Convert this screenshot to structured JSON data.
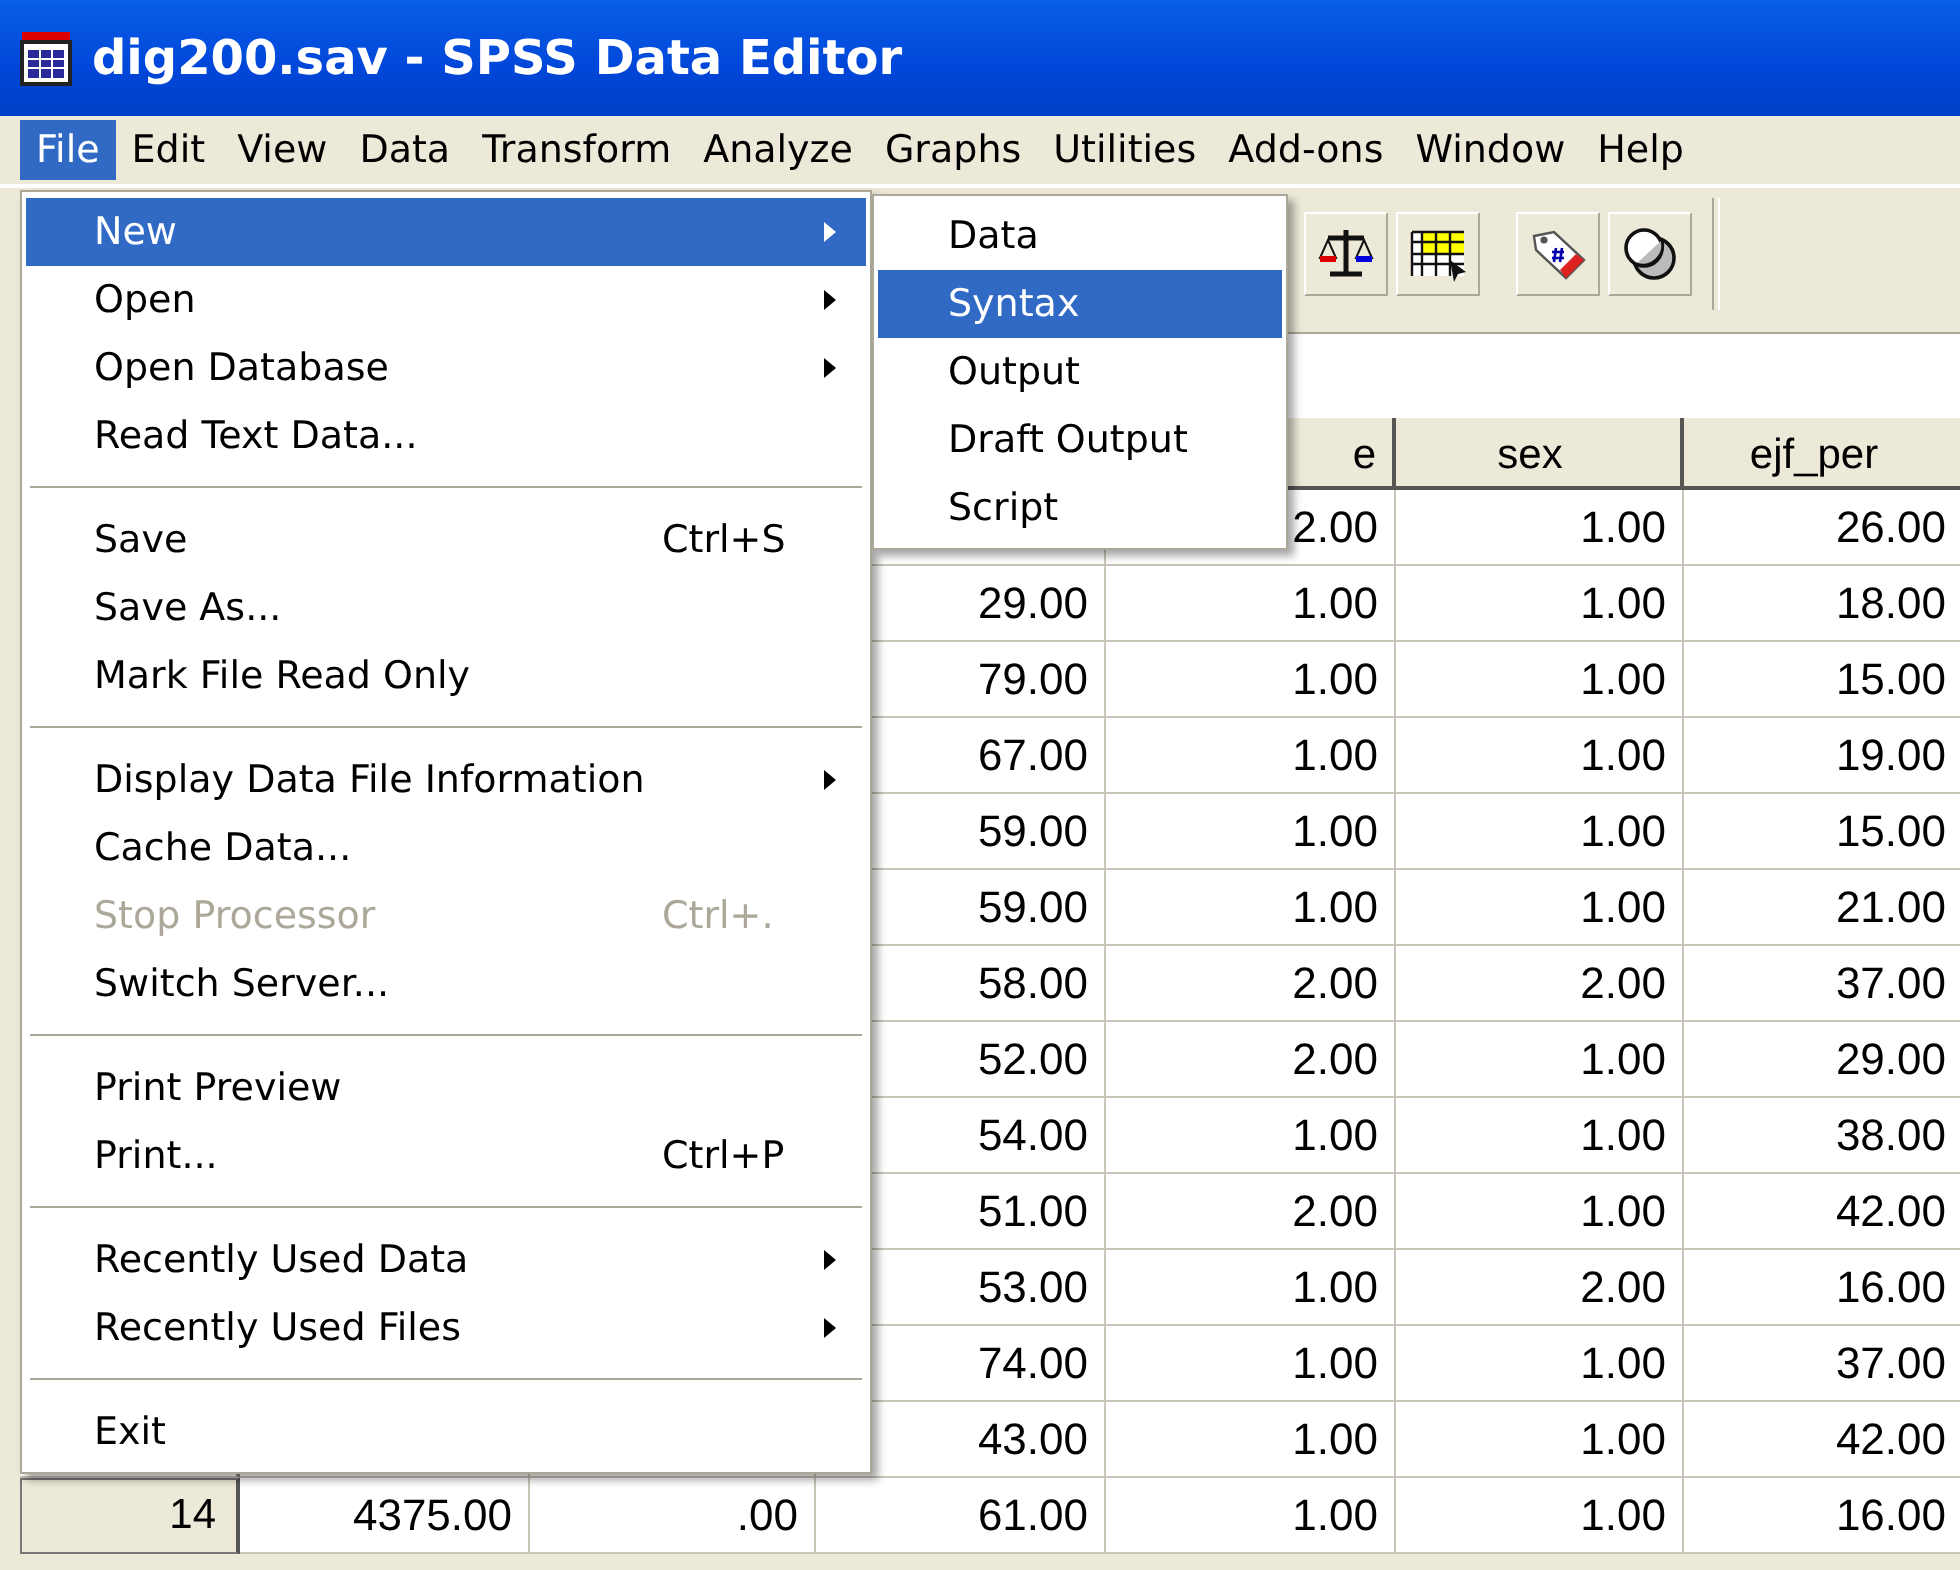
{
  "window": {
    "title": "dig200.sav - SPSS Data Editor"
  },
  "menu_bar": [
    {
      "label": "File",
      "selected": true
    },
    {
      "label": "Edit",
      "selected": false
    },
    {
      "label": "View",
      "selected": false
    },
    {
      "label": "Data",
      "selected": false
    },
    {
      "label": "Transform",
      "selected": false
    },
    {
      "label": "Analyze",
      "selected": false
    },
    {
      "label": "Graphs",
      "selected": false
    },
    {
      "label": "Utilities",
      "selected": false
    },
    {
      "label": "Add-ons",
      "selected": false
    },
    {
      "label": "Window",
      "selected": false
    },
    {
      "label": "Help",
      "selected": false
    }
  ],
  "file_menu": [
    {
      "kind": "item",
      "label": "New",
      "submenu": true,
      "selected": true,
      "disabled": false
    },
    {
      "kind": "item",
      "label": "Open",
      "submenu": true,
      "selected": false,
      "disabled": false
    },
    {
      "kind": "item",
      "label": "Open Database",
      "submenu": true,
      "selected": false,
      "disabled": false
    },
    {
      "kind": "item",
      "label": "Read Text Data...",
      "submenu": false,
      "selected": false,
      "disabled": false
    },
    {
      "kind": "separator"
    },
    {
      "kind": "item",
      "label": "Save",
      "shortcut": "Ctrl+S",
      "submenu": false,
      "selected": false,
      "disabled": false
    },
    {
      "kind": "item",
      "label": "Save As...",
      "submenu": false,
      "selected": false,
      "disabled": false
    },
    {
      "kind": "item",
      "label": "Mark File Read Only",
      "submenu": false,
      "selected": false,
      "disabled": false
    },
    {
      "kind": "separator"
    },
    {
      "kind": "item",
      "label": "Display Data File Information",
      "submenu": true,
      "selected": false,
      "disabled": false
    },
    {
      "kind": "item",
      "label": "Cache Data...",
      "submenu": false,
      "selected": false,
      "disabled": false
    },
    {
      "kind": "item",
      "label": "Stop Processor",
      "shortcut": "Ctrl+.",
      "submenu": false,
      "selected": false,
      "disabled": true
    },
    {
      "kind": "item",
      "label": "Switch Server...",
      "submenu": false,
      "selected": false,
      "disabled": false
    },
    {
      "kind": "separator"
    },
    {
      "kind": "item",
      "label": "Print Preview",
      "submenu": false,
      "selected": false,
      "disabled": false
    },
    {
      "kind": "item",
      "label": "Print...",
      "shortcut": "Ctrl+P",
      "submenu": false,
      "selected": false,
      "disabled": false
    },
    {
      "kind": "separator"
    },
    {
      "kind": "item",
      "label": "Recently Used Data",
      "submenu": true,
      "selected": false,
      "disabled": false
    },
    {
      "kind": "item",
      "label": "Recently Used Files",
      "submenu": true,
      "selected": false,
      "disabled": false
    },
    {
      "kind": "separator"
    },
    {
      "kind": "item",
      "label": "Exit",
      "submenu": false,
      "selected": false,
      "disabled": false
    }
  ],
  "new_submenu": [
    {
      "label": "Data",
      "selected": false
    },
    {
      "label": "Syntax",
      "selected": true
    },
    {
      "label": "Output",
      "selected": false
    },
    {
      "label": "Draft Output",
      "selected": false
    },
    {
      "label": "Script",
      "selected": false
    }
  ],
  "grid": {
    "columns": [
      null,
      null,
      null,
      "e",
      "sex",
      "ejf_per"
    ],
    "rows": [
      {
        "header": null,
        "cells": [
          null,
          null,
          null,
          "2.00",
          "1.00",
          "26.00"
        ]
      },
      {
        "header": null,
        "cells": [
          null,
          null,
          "29.00",
          "1.00",
          "1.00",
          "18.00"
        ]
      },
      {
        "header": null,
        "cells": [
          null,
          null,
          "79.00",
          "1.00",
          "1.00",
          "15.00"
        ]
      },
      {
        "header": null,
        "cells": [
          null,
          null,
          "67.00",
          "1.00",
          "1.00",
          "19.00"
        ]
      },
      {
        "header": null,
        "cells": [
          null,
          null,
          "59.00",
          "1.00",
          "1.00",
          "15.00"
        ]
      },
      {
        "header": null,
        "cells": [
          null,
          null,
          "59.00",
          "1.00",
          "1.00",
          "21.00"
        ]
      },
      {
        "header": null,
        "cells": [
          null,
          null,
          "58.00",
          "2.00",
          "2.00",
          "37.00"
        ]
      },
      {
        "header": null,
        "cells": [
          null,
          null,
          "52.00",
          "2.00",
          "1.00",
          "29.00"
        ]
      },
      {
        "header": null,
        "cells": [
          null,
          null,
          "54.00",
          "1.00",
          "1.00",
          "38.00"
        ]
      },
      {
        "header": null,
        "cells": [
          null,
          null,
          "51.00",
          "2.00",
          "1.00",
          "42.00"
        ]
      },
      {
        "header": null,
        "cells": [
          null,
          null,
          "53.00",
          "1.00",
          "2.00",
          "16.00"
        ]
      },
      {
        "header": null,
        "cells": [
          null,
          null,
          "74.00",
          "1.00",
          "1.00",
          "37.00"
        ]
      },
      {
        "header": null,
        "cells": [
          null,
          null,
          "43.00",
          "1.00",
          "1.00",
          "42.00"
        ]
      },
      {
        "header": "14",
        "cells": [
          "4375.00",
          ".00",
          "61.00",
          "1.00",
          "1.00",
          "16.00"
        ]
      }
    ]
  }
}
